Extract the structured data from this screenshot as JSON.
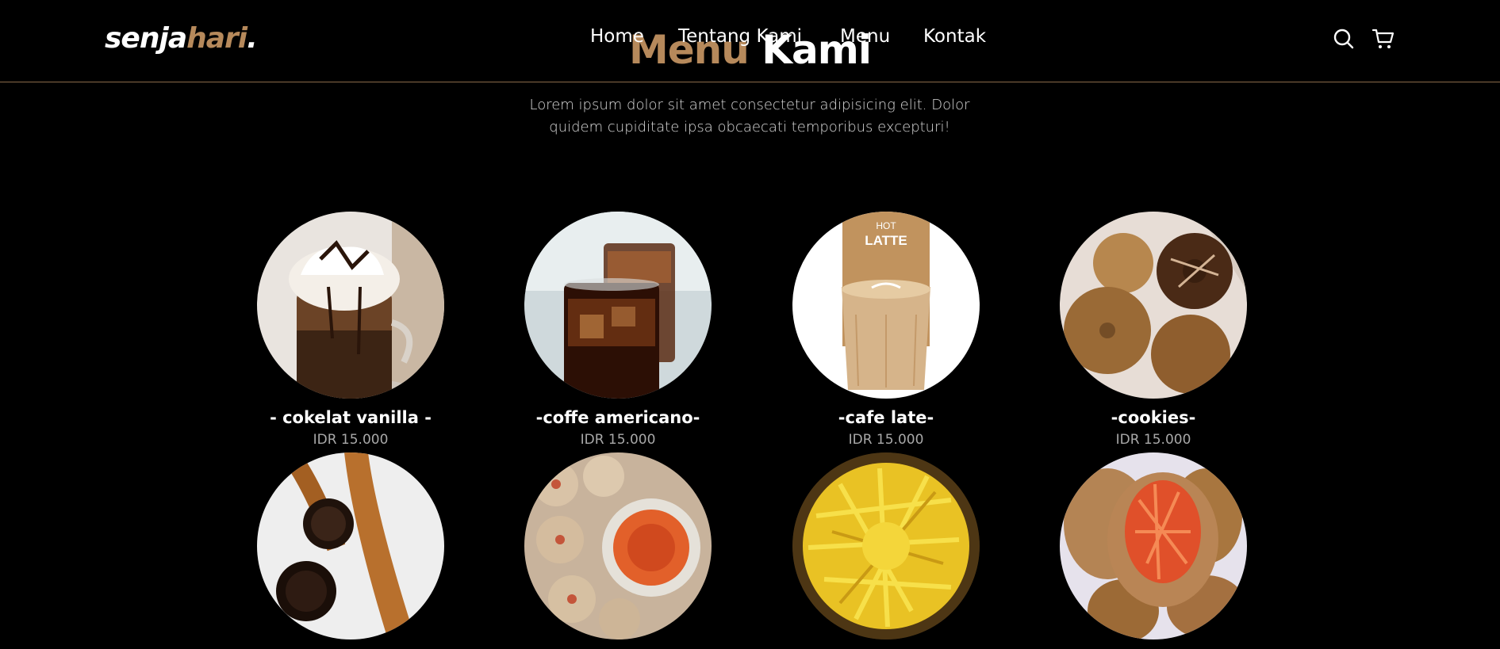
{
  "brand": {
    "part1": "senja",
    "part2": "hari",
    "part3": "."
  },
  "nav": {
    "links": [
      "Home",
      "Tentang Kami",
      "Menu",
      "Kontak"
    ],
    "icons": [
      "search-icon",
      "cart-icon"
    ]
  },
  "menu_section": {
    "heading_part1": "Menu",
    "heading_part2": "Kami",
    "description": "Lorem ipsum dolor sit amet consectetur adipisicing elit. Dolor quidem cupiditate ipsa obcaecati temporibus excepturi!",
    "items": [
      {
        "name": "- cokelat vanilla -",
        "price": "IDR 15.000",
        "image": "hot chocolate with whipped cream"
      },
      {
        "name": "-coffe americano-",
        "price": "IDR 15.000",
        "image": "iced americano glasses"
      },
      {
        "name": "-cafe late-",
        "price": "IDR 15.000",
        "image": "hot latte glass",
        "image_text_top": "HOT",
        "image_text_bottom": "LATTE"
      },
      {
        "name": "-cookies-",
        "price": "IDR 15.000",
        "image": "cookies in box"
      },
      {
        "name": "",
        "price": "",
        "image": "churros with chocolate dip"
      },
      {
        "name": "",
        "price": "",
        "image": "dumplings with chili sauce"
      },
      {
        "name": "",
        "price": "",
        "image": "fried noodle snack"
      },
      {
        "name": "",
        "price": "",
        "image": "pastel pastries"
      }
    ]
  },
  "colors": {
    "accent": "#b6895b",
    "background": "#000000",
    "text": "#ffffff",
    "muted": "#a8a8a8"
  }
}
